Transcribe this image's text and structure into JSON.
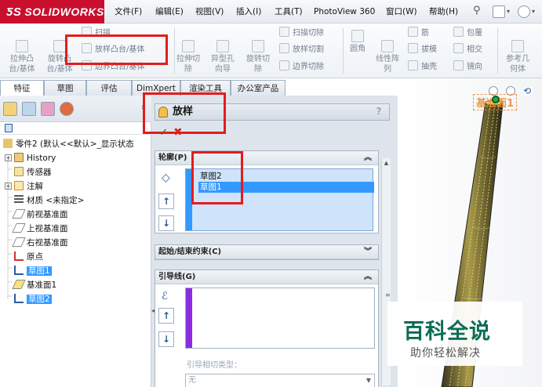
{
  "app": {
    "brand": "SOLIDWORKS",
    "menus": [
      "文件(F)",
      "编辑(E)",
      "视图(V)",
      "插入(I)",
      "工具(T)",
      "PhotoView 360",
      "窗口(W)",
      "帮助(H)"
    ]
  },
  "ribbon": {
    "extrude_boss": "拉伸凸\n台/基体",
    "revolve_boss": "旋转凸\n台/基体",
    "sweep": "扫描",
    "loft_boss": "放样凸台/基体",
    "boundary_boss": "边界凸台/基体",
    "extrude_cut": "拉伸切\n除",
    "hole_wizard": "异型孔\n向导",
    "revolve_cut": "旋转切\n除",
    "swept_cut": "扫描切除",
    "lofted_cut": "放样切割",
    "boundary_cut": "边界切除",
    "fillet": "圆角",
    "linear_pattern": "线性阵\n列",
    "rib": "筋",
    "draft": "拔模",
    "shell": "抽壳",
    "wrap": "包覆",
    "intersect": "相交",
    "mirror": "镜向",
    "ref_geometry": "参考几\n何体"
  },
  "tabs": [
    "特征",
    "草图",
    "评估",
    "DimXpert",
    "渲染工具",
    "办公室产品"
  ],
  "feature_tree": {
    "part": "零件2 (默认<<默认>_显示状态",
    "items": [
      "History",
      "传感器",
      "注解",
      "材质 <未指定>",
      "前视基准面",
      "上视基准面",
      "右视基准面",
      "原点",
      "草图1",
      "基准面1",
      "草图2"
    ]
  },
  "property_manager": {
    "title": "放样",
    "help": "?",
    "profiles_header": "轮廓(P)",
    "profiles": [
      "草图2",
      "草图1"
    ],
    "start_end_header": "起始/结束约束(C)",
    "guides_header": "引导线(G)",
    "guide_tangency_label": "引导相切类型：",
    "guide_tangency_value": "无"
  },
  "graphics": {
    "plane_label": "基准面1"
  },
  "watermark": {
    "title": "百科全说",
    "subtitle": "助你轻松解决"
  },
  "colors": {
    "brand_red": "#c8102e",
    "selection_blue": "#3399ff",
    "annotation_red": "#e21d1d",
    "watermark_green": "#0b6d55"
  }
}
